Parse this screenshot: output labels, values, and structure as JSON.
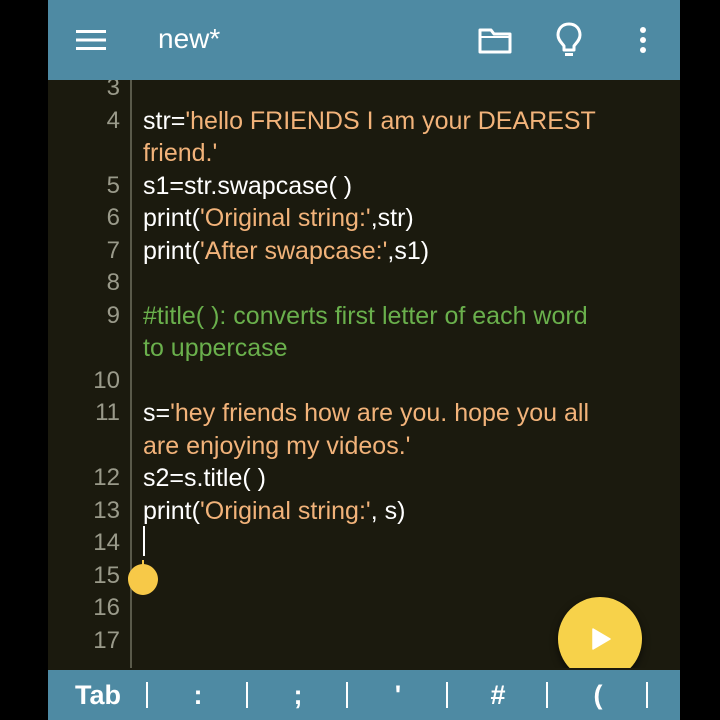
{
  "toolbar": {
    "title": "new*",
    "icons": [
      "menu-icon",
      "folder-icon",
      "lightbulb-icon",
      "more-vert-icon"
    ]
  },
  "colors": {
    "toolbar_bg": "#4e8aa3",
    "editor_bg": "#1b1a0e",
    "string": "#f2b37a",
    "comment": "#6ab04c",
    "line_number": "#9a9a8a",
    "fab": "#f7d24a"
  },
  "editor": {
    "lines": [
      {
        "n": "3",
        "text": ""
      },
      {
        "n": "4",
        "text": "str='hello FRIENDS I am your DEAREST"
      },
      {
        "n": "",
        "text": "friend.'"
      },
      {
        "n": "5",
        "text": "s1=str.swapcase( )"
      },
      {
        "n": "6",
        "text": "print('Original string:',str)"
      },
      {
        "n": "7",
        "text": "print('After swapcase:',s1)"
      },
      {
        "n": "8",
        "text": ""
      },
      {
        "n": "9",
        "text": "#title( ): converts first letter of each word"
      },
      {
        "n": "",
        "text": "to uppercase"
      },
      {
        "n": "10",
        "text": ""
      },
      {
        "n": "11",
        "text": "s='hey friends how are you. hope you all"
      },
      {
        "n": "",
        "text": "are enjoying my videos.'"
      },
      {
        "n": "12",
        "text": "s2=s.title( )"
      },
      {
        "n": "13",
        "text": "print('Original string:', s)"
      },
      {
        "n": "14",
        "text": ""
      },
      {
        "n": "15",
        "text": ""
      },
      {
        "n": "16",
        "text": ""
      },
      {
        "n": "17",
        "text": ""
      }
    ]
  },
  "fab": {
    "icon": "play-icon"
  },
  "symbol_bar": {
    "keys": [
      "Tab",
      ":",
      ";",
      "'",
      "#",
      "("
    ]
  }
}
